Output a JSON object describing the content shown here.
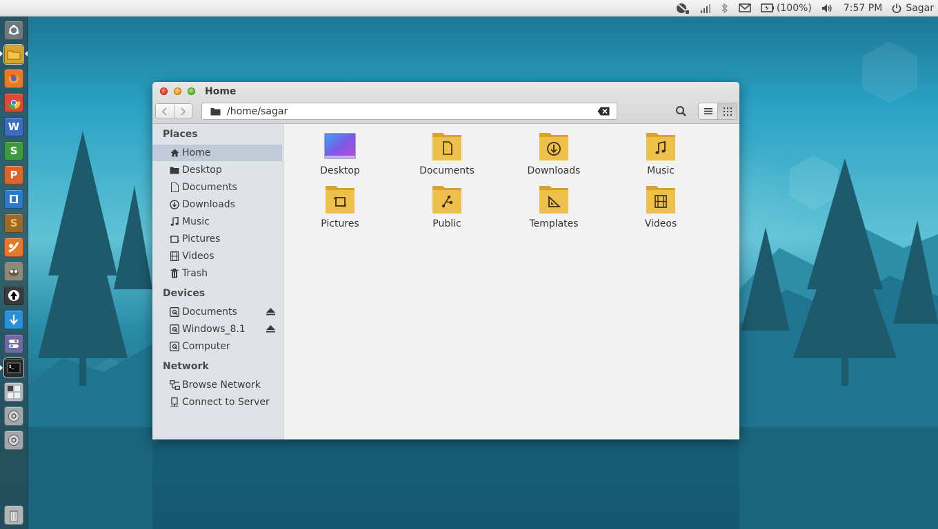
{
  "top_panel": {
    "battery": "(100%)",
    "time": "7:57 PM",
    "user": "Sagar",
    "icons": [
      "network-manager-icon",
      "signal-icon",
      "bluetooth-icon",
      "mail-icon",
      "battery-icon",
      "volume-icon",
      "power-icon"
    ]
  },
  "launcher": {
    "items": [
      {
        "name": "dash-home",
        "icon": "ubuntu-logo-icon",
        "color": "#6e7a80"
      },
      {
        "name": "files",
        "icon": "folder-icon",
        "color": "#d8a52c"
      },
      {
        "name": "firefox",
        "icon": "firefox-icon",
        "color": "#e57a2a"
      },
      {
        "name": "chrome",
        "icon": "chrome-icon",
        "color": "#d94a3c"
      },
      {
        "name": "libreoffice-writer",
        "icon": "writer-icon",
        "color": "#3a6cc6",
        "glyph": "W"
      },
      {
        "name": "libreoffice-calc",
        "icon": "calc-icon",
        "color": "#3e9a3e",
        "glyph": "S"
      },
      {
        "name": "libreoffice-impress",
        "icon": "impress-icon",
        "color": "#d8662a",
        "glyph": "P"
      },
      {
        "name": "teamviewer",
        "icon": "window-icon",
        "color": "#2a7ac8"
      },
      {
        "name": "sublime-text",
        "icon": "sublime-icon",
        "color": "#9a6a2a",
        "glyph": "S"
      },
      {
        "name": "ubuntu-one",
        "icon": "swirl-icon",
        "color": "#e8772a"
      },
      {
        "name": "gimp",
        "icon": "gimp-icon",
        "color": "#8a8a7a"
      },
      {
        "name": "inkscape",
        "icon": "inkscape-icon",
        "color": "#3a3a3a"
      },
      {
        "name": "downloader",
        "icon": "download-arrow-icon",
        "color": "#2a90d8"
      },
      {
        "name": "settings",
        "icon": "toggles-icon",
        "color": "#6a6aa0"
      },
      {
        "name": "terminal",
        "icon": "terminal-icon",
        "color": "#2a2a2a"
      },
      {
        "name": "workspace-switcher",
        "icon": "workspaces-icon",
        "color": "#b0b8bc"
      },
      {
        "name": "disk-1",
        "icon": "disk-icon",
        "color": "#a0a8ac"
      },
      {
        "name": "disk-2",
        "icon": "disk-icon",
        "color": "#a0a8ac"
      },
      {
        "name": "trash",
        "icon": "trash-icon",
        "color": "#b0b6b8"
      }
    ]
  },
  "window": {
    "title": "Home",
    "path": "/home/sagar",
    "sidebar": {
      "places_heading": "Places",
      "places": [
        {
          "label": "Home",
          "icon": "home-icon",
          "selected": true
        },
        {
          "label": "Desktop",
          "icon": "folder-icon"
        },
        {
          "label": "Documents",
          "icon": "document-icon"
        },
        {
          "label": "Downloads",
          "icon": "download-icon"
        },
        {
          "label": "Music",
          "icon": "music-icon"
        },
        {
          "label": "Pictures",
          "icon": "picture-icon"
        },
        {
          "label": "Videos",
          "icon": "film-icon"
        },
        {
          "label": "Trash",
          "icon": "trash-icon"
        }
      ],
      "devices_heading": "Devices",
      "devices": [
        {
          "label": "Documents",
          "icon": "drive-icon",
          "eject": true
        },
        {
          "label": "Windows_8.1",
          "icon": "drive-icon",
          "eject": true
        },
        {
          "label": "Computer",
          "icon": "drive-icon",
          "eject": false
        }
      ],
      "network_heading": "Network",
      "network": [
        {
          "label": "Browse Network",
          "icon": "network-icon"
        },
        {
          "label": "Connect to Server",
          "icon": "server-icon"
        }
      ]
    },
    "files": [
      {
        "label": "Desktop",
        "icon": "desktop-folder-icon"
      },
      {
        "label": "Documents",
        "icon": "documents-folder-icon"
      },
      {
        "label": "Downloads",
        "icon": "downloads-folder-icon"
      },
      {
        "label": "Music",
        "icon": "music-folder-icon"
      },
      {
        "label": "Pictures",
        "icon": "pictures-folder-icon"
      },
      {
        "label": "Public",
        "icon": "public-folder-icon"
      },
      {
        "label": "Templates",
        "icon": "templates-folder-icon"
      },
      {
        "label": "Videos",
        "icon": "videos-folder-icon"
      }
    ]
  }
}
